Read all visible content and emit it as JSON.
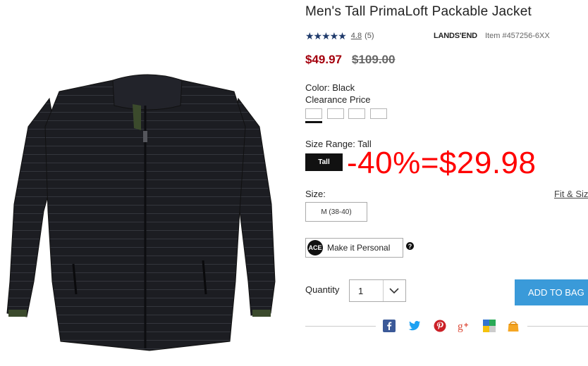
{
  "product": {
    "title": "Men's Tall PrimaLoft Packable Jacket",
    "stars": "★★★★★",
    "rating": "4.8",
    "review_count": "(5)",
    "brand": "LANDS'END",
    "item_number": "Item #457256-6XX",
    "sale_price": "$49.97",
    "original_price": "$109.00"
  },
  "options": {
    "color_label": "Color: Black",
    "clearance_label": "Clearance Price",
    "size_range_label": "Size Range: Tall",
    "size_range_button": "Tall",
    "size_label": "Size:",
    "fit_size_link": "Fit & Siz",
    "size_option": "M (38-40)"
  },
  "promo": {
    "text": "-40%=$29.98",
    "color": "#ff0000"
  },
  "personalize": {
    "icon_text": "ACE",
    "label": "Make it Personal",
    "help": "?"
  },
  "quantity": {
    "label": "Quantity",
    "value": "1"
  },
  "cart": {
    "add_to_bag": "ADD TO BAG"
  },
  "colors": {
    "sale_price": "#a4000d",
    "add_to_bag_bg": "#3a9ad9"
  },
  "share_icons": [
    "facebook-icon",
    "twitter-icon",
    "pinterest-icon",
    "google-plus-icon",
    "delicious-icon",
    "shopping-bag-icon"
  ]
}
